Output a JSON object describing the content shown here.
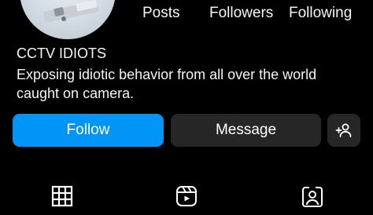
{
  "profile": {
    "name": "CCTV IDIOTS",
    "bio": "Exposing idiotic behavior from all over the world caught on camera.",
    "avatar_icon": "cctv-camera-avatar"
  },
  "stats": {
    "posts_label": "Posts",
    "followers_label": "Followers",
    "following_label": "Following"
  },
  "actions": {
    "follow_label": "Follow",
    "message_label": "Message",
    "suggest_icon": "add-person-icon"
  },
  "tabs": [
    {
      "icon": "grid-icon"
    },
    {
      "icon": "reels-icon"
    },
    {
      "icon": "tagged-icon"
    }
  ],
  "colors": {
    "background": "#000000",
    "follow_button": "#0095f6",
    "secondary_button": "#262626",
    "text": "#f5f5f5"
  }
}
